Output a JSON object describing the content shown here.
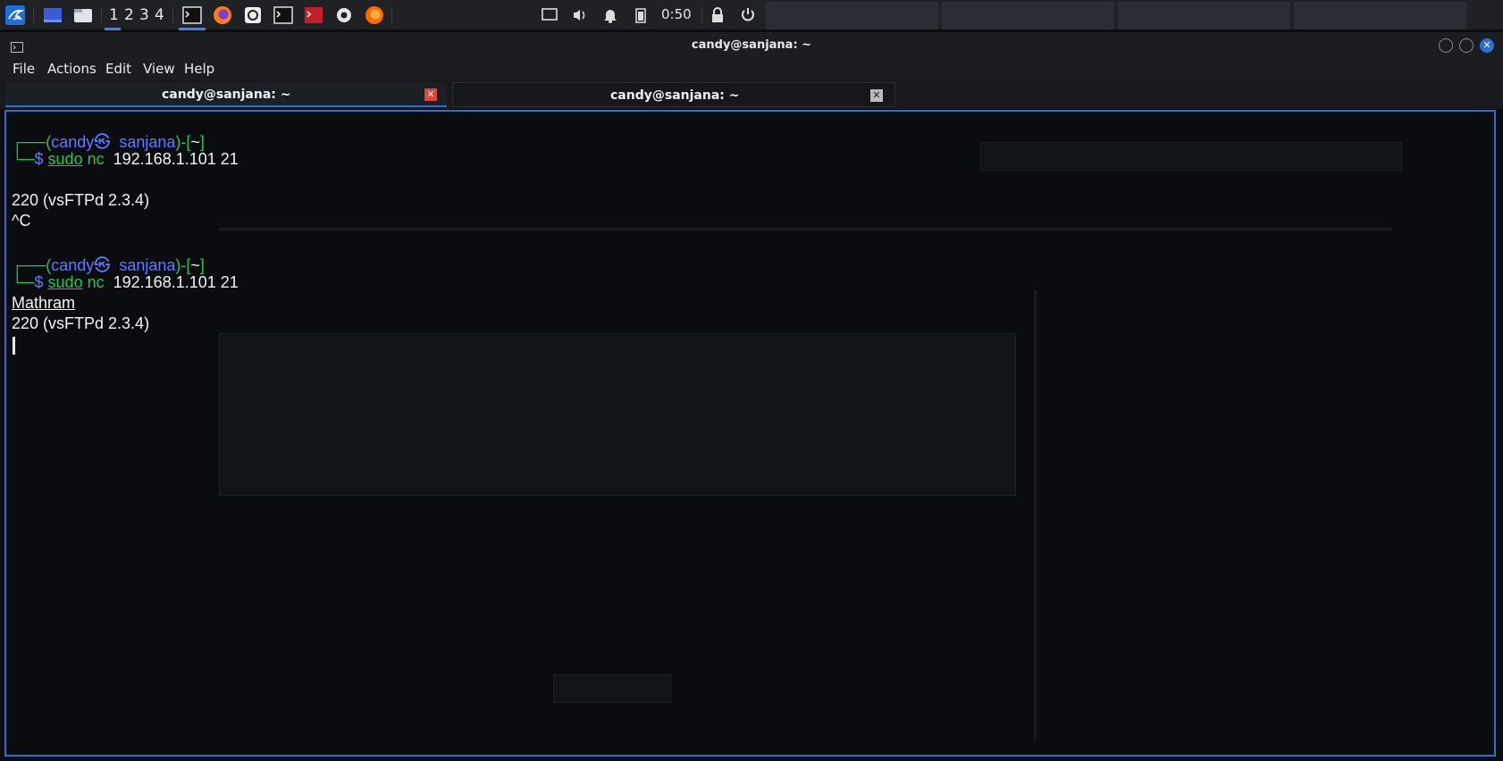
{
  "panel": {
    "workspaces": [
      "1",
      "2",
      "3",
      "4"
    ],
    "active_workspace": "1",
    "clock": "0:50",
    "icons": [
      "kali-menu-icon",
      "desktop-icon",
      "file-manager-icon",
      "terminal-icon",
      "firefox-icon",
      "screenshot-icon",
      "terminal-icon",
      "terminal-root-icon",
      "settings-gear-icon",
      "firefox-icon",
      "display-icon",
      "volume-icon",
      "bell-icon",
      "battery-icon",
      "lock-icon",
      "power-icon"
    ]
  },
  "window": {
    "title": "candy@sanjana: ~",
    "menu": [
      "File",
      "Actions",
      "Edit",
      "View",
      "Help"
    ],
    "tabs": [
      {
        "label": "candy@sanjana: ~",
        "active": true
      },
      {
        "label": "candy@sanjana: ~",
        "active": false
      }
    ]
  },
  "terminal": {
    "prompt1": {
      "open": "┌──(",
      "user": "candy",
      "skull": "㉿",
      "host": "sanjana",
      "mid": ")-[",
      "dir": "~",
      "close": "]",
      "corner": "└─",
      "dollar": "$",
      "cmd": "sudo",
      "prog": "nc",
      "args": "192.168.1.101 21"
    },
    "out1": "220 (vsFTPd 2.3.4)",
    "out2": "^C",
    "prompt2": {
      "open": "┌──(",
      "user": "candy",
      "skull": "㉿",
      "host": "sanjana",
      "mid": ")-[",
      "dir": "~",
      "close": "]",
      "corner": "└─",
      "dollar": "$",
      "cmd": "sudo",
      "prog": "nc",
      "args": "192.168.1.101 21"
    },
    "out3": "Mathram",
    "out4": "220 (vsFTPd 2.3.4)"
  },
  "colors": {
    "accent_blue": "#2b6fd6",
    "prompt_green": "#22c55e",
    "prompt_blue": "#5b7cff",
    "close_red": "#e0443e"
  }
}
